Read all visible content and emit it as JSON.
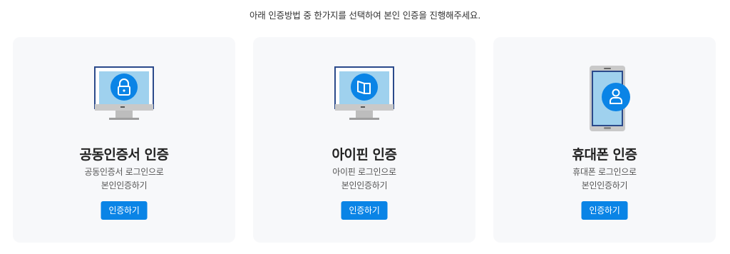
{
  "intro_text": "아래 인증방법 중 한가지를 선택하여 본인 인증을 진행해주세요.",
  "cards": [
    {
      "title": "공동인증서 인증",
      "desc_line1": "공동인증서 로그인으로",
      "desc_line2": "본인인증하기",
      "button": "인증하기",
      "icon": "certificate-lock-icon"
    },
    {
      "title": "아이핀 인증",
      "desc_line1": "아이핀 로그인으로",
      "desc_line2": "본인인증하기",
      "button": "인증하기",
      "icon": "ipin-card-icon"
    },
    {
      "title": "휴대폰 인증",
      "desc_line1": "휴대폰 로그인으로",
      "desc_line2": "본인인증하기",
      "button": "인증하기",
      "icon": "phone-user-icon"
    }
  ],
  "colors": {
    "accent": "#0a84e6",
    "card_bg": "#f7f8fa",
    "screen": "#9fd1ee",
    "frame": "#2b4a8b"
  }
}
